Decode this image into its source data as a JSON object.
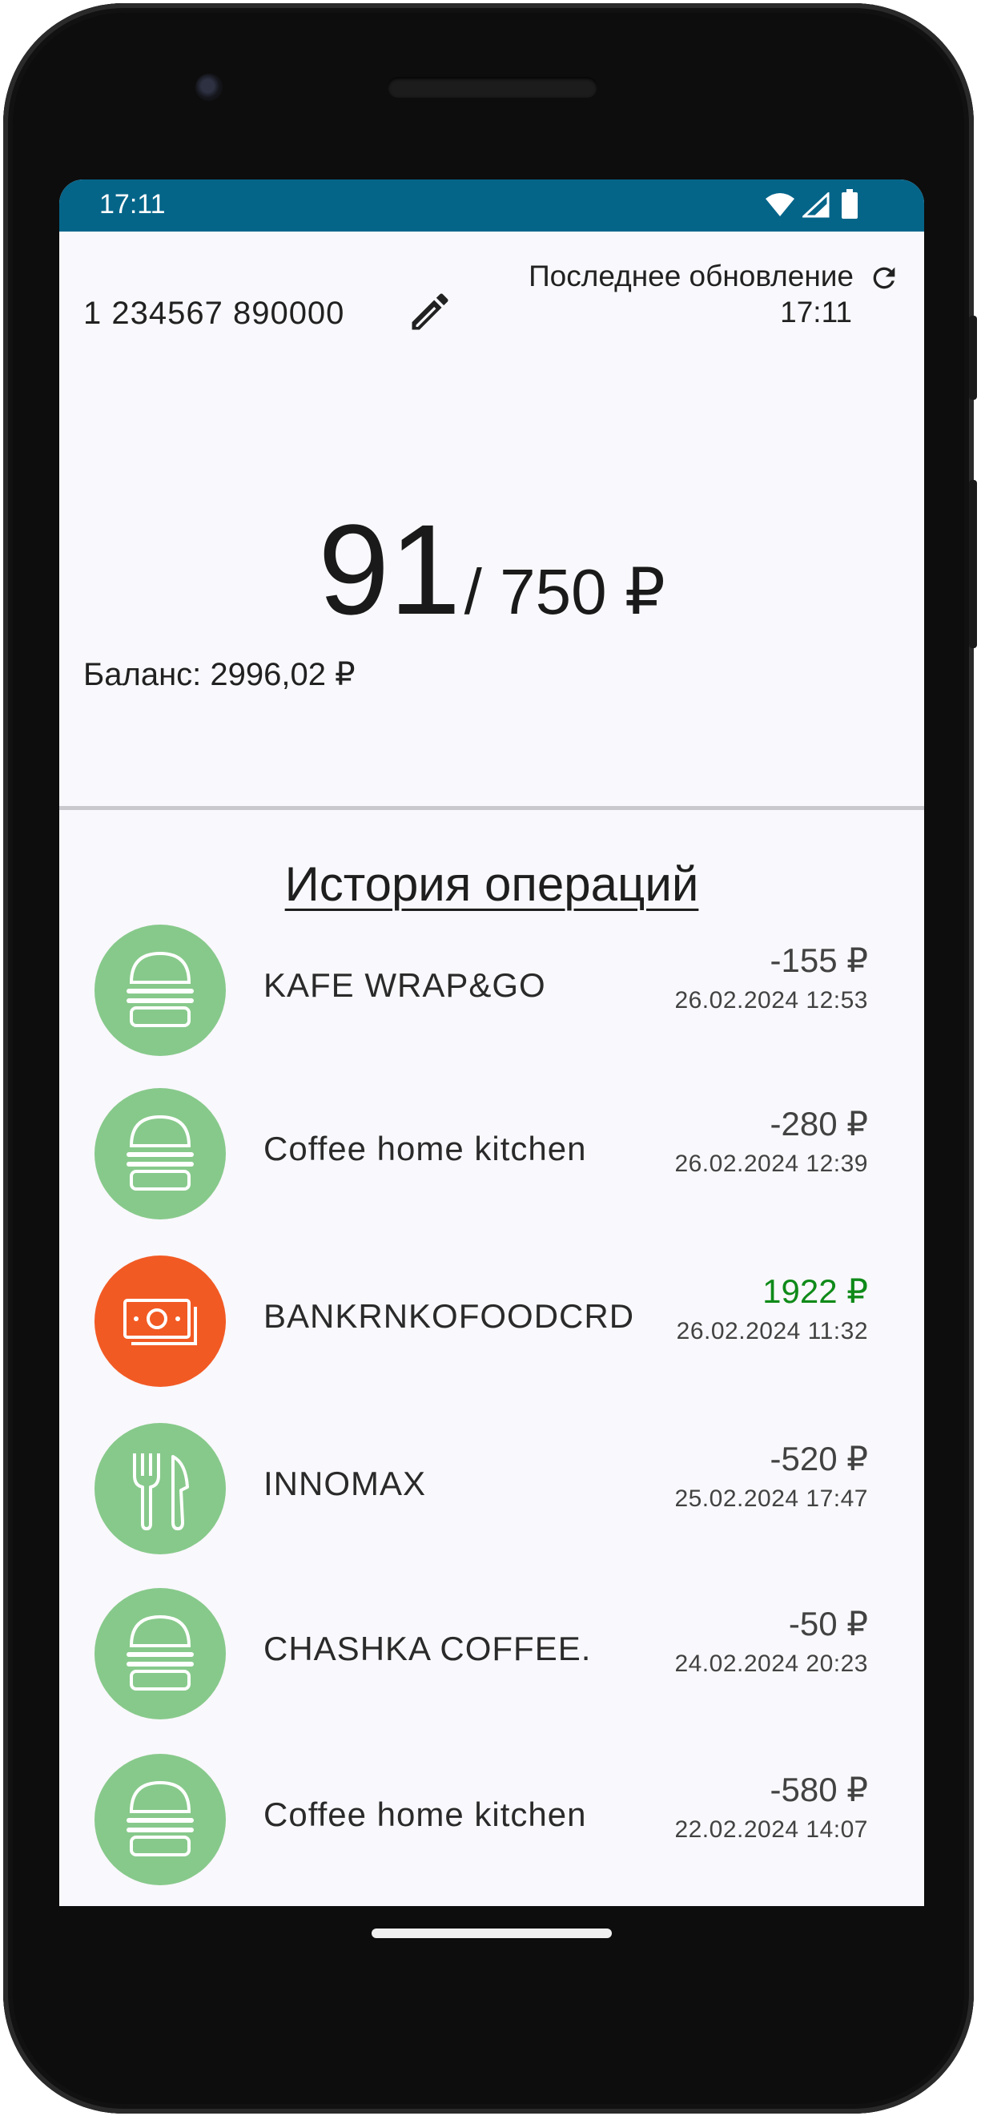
{
  "status_bar": {
    "time": "17:11"
  },
  "card": {
    "number": "1 234567 890000"
  },
  "last_update": {
    "label": "Последнее обновление",
    "time": "17:11"
  },
  "spending": {
    "spent": "91",
    "limit": "/ 750 ₽"
  },
  "balance": {
    "text": "Баланс: 2996,02 ₽"
  },
  "history": {
    "title": "История операций",
    "items": [
      {
        "name": "KAFE WRAP&GO",
        "amount": "-155 ₽",
        "date": "26.02.2024 12:53",
        "icon": "burger-icon",
        "color": "#87c98b",
        "amount_color": "#424242"
      },
      {
        "name": "Coffee home kitchen",
        "amount": "-280 ₽",
        "date": "26.02.2024 12:39",
        "icon": "burger-icon",
        "color": "#87c98b",
        "amount_color": "#424242"
      },
      {
        "name": "BANKRNKOFOODCRD",
        "amount": "1922 ₽",
        "date": "26.02.2024 11:32",
        "icon": "cash-icon",
        "color": "#f25a24",
        "amount_color": "#0f8a19"
      },
      {
        "name": "INNOMAX",
        "amount": "-520 ₽",
        "date": "25.02.2024 17:47",
        "icon": "fork-knife-icon",
        "color": "#87c98b",
        "amount_color": "#424242"
      },
      {
        "name": "CHASHKA COFFEE.",
        "amount": "-50 ₽",
        "date": "24.02.2024 20:23",
        "icon": "burger-icon",
        "color": "#87c98b",
        "amount_color": "#424242"
      },
      {
        "name": "Coffee home kitchen",
        "amount": "-580 ₽",
        "date": "22.02.2024 14:07",
        "icon": "burger-icon",
        "color": "#87c98b",
        "amount_color": "#424242"
      }
    ]
  },
  "colors": {
    "status_bar": "#056589",
    "income": "#0f8a19",
    "expense": "#424242"
  }
}
